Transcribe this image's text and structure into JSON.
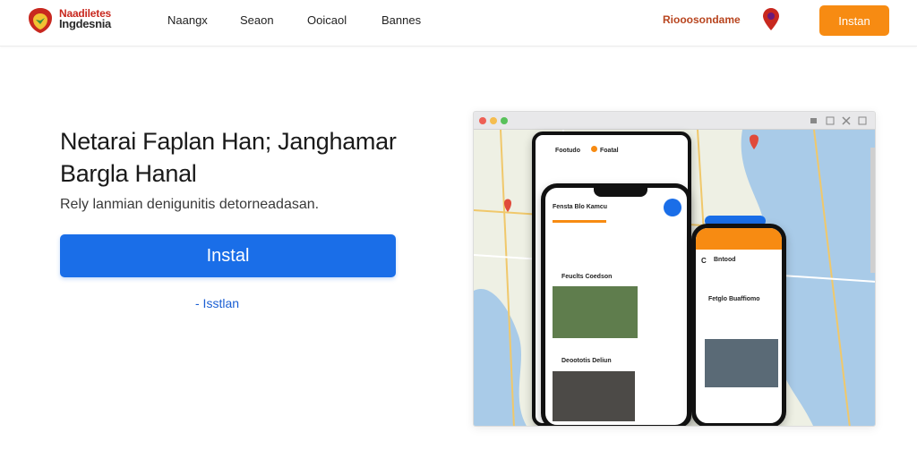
{
  "header": {
    "logo": {
      "line1": "Naadiletes",
      "line2": "Ingdesnia"
    },
    "nav": [
      "Naangx",
      "Seaon",
      "Ooicaol",
      "Bannes"
    ],
    "right_link": "Riooosondame",
    "cta": "Instan"
  },
  "hero": {
    "title": "Netarai Faplan Han; Janghamar Bargla Hanal",
    "subtitle": "Rely lanmian denigunitis detorneadasan.",
    "install_button": "Instal",
    "secondary_link": "- Isstlan"
  },
  "illustration": {
    "app_title": "Footudo",
    "app_title2": "Foatal",
    "card1_title": "Fensta Blo Kamcu",
    "card2_title": "Feuclts Coedson",
    "card3_title": "Deoototis Deliun",
    "phone2_header": "C",
    "phone2_label": "Bntood",
    "phone2_card_title": "Fetglo Buaffiomo",
    "colors": {
      "orange": "#f78b12",
      "blue": "#1a6ee8",
      "water": "#a9cbe8",
      "land": "#eef0e4"
    }
  }
}
